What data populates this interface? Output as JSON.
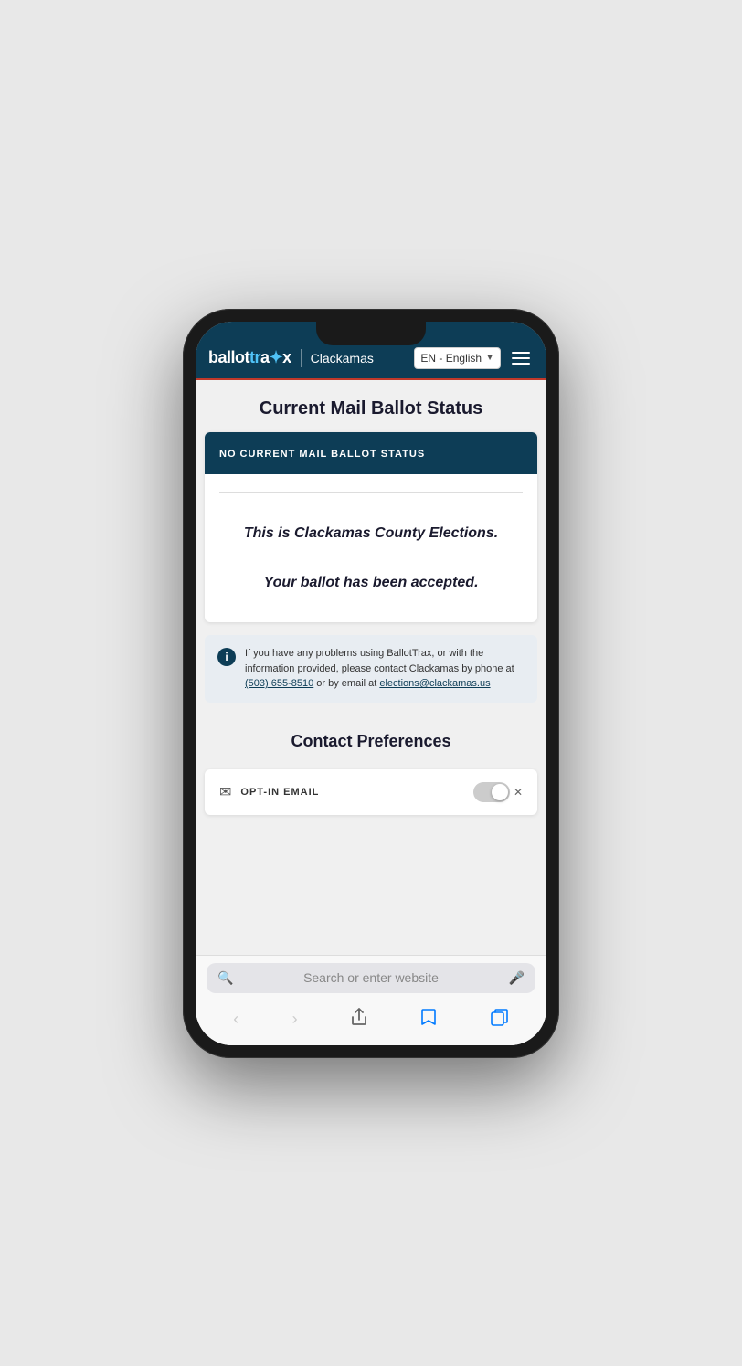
{
  "header": {
    "brand": "ballottrax",
    "county": "Clackamas",
    "language": "EN - English",
    "menu_label": "Menu"
  },
  "page": {
    "title": "Current Mail Ballot Status",
    "status_banner": "NO CURRENT MAIL BALLOT STATUS",
    "status_message_line1": "This is Clackamas County Elections.",
    "status_message_line2": "Your ballot has been accepted."
  },
  "info": {
    "text_before_phone": "If you have any problems using BallotTrax, or with the information provided, please contact Clackamas by phone at ",
    "phone": "(503) 655-8510",
    "text_between": " or by email at ",
    "email": "elections@clackamas.us"
  },
  "contact_preferences": {
    "title": "Contact Preferences",
    "opt_in_label": "OPT-IN EMAIL"
  },
  "safari": {
    "search_placeholder": "Search or enter website"
  },
  "icons": {
    "info": "i",
    "mail": "✉",
    "search": "🔍",
    "mic": "🎤",
    "back": "‹",
    "forward": "›",
    "share": "↑",
    "bookmarks": "📖",
    "tabs": "⧉"
  }
}
